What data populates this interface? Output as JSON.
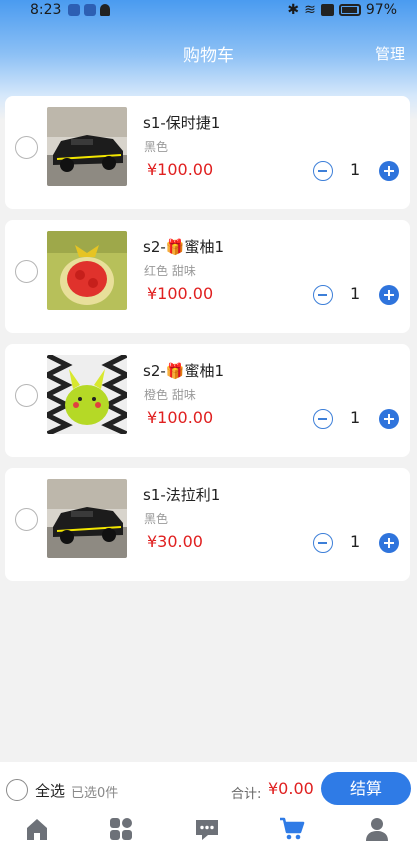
{
  "status_bar": {
    "time": "8:23",
    "battery": "97%"
  },
  "header": {
    "title": "购物车",
    "manage_label": "管理"
  },
  "cart_items": [
    {
      "name": "s1-保时捷1",
      "spec": "黑色",
      "price": "¥100.00",
      "quantity": "1",
      "image": "black-sports-car"
    },
    {
      "name": "s2-",
      "emoji": "🎁",
      "name_suffix": "蜜柚1",
      "spec": "红色   甜味",
      "price": "¥100.00",
      "quantity": "1",
      "image": "strawberry-fruit-bowl"
    },
    {
      "name": "s2-",
      "emoji": "🎁",
      "name_suffix": "蜜柚1",
      "spec": "橙色   甜味",
      "price": "¥100.00",
      "quantity": "1",
      "image": "pikachu-melon"
    },
    {
      "name": "s1-法拉利1",
      "spec": "黑色",
      "price": "¥30.00",
      "quantity": "1",
      "image": "black-sports-car"
    }
  ],
  "footer": {
    "select_all_label": "全选",
    "selected_count_text": "已选0件",
    "total_label": "合计:",
    "total_value": "¥0.00",
    "checkout_label": "结算"
  },
  "tabbar": [
    {
      "name": "home-icon",
      "active": false
    },
    {
      "name": "category-icon",
      "active": false
    },
    {
      "name": "message-icon",
      "active": false
    },
    {
      "name": "cart-icon",
      "active": true
    },
    {
      "name": "profile-icon",
      "active": false
    }
  ],
  "colors": {
    "accent": "#2f7be6",
    "price": "#e02020",
    "tab_inactive": "#6d7178",
    "tab_active": "#2f7be6"
  }
}
